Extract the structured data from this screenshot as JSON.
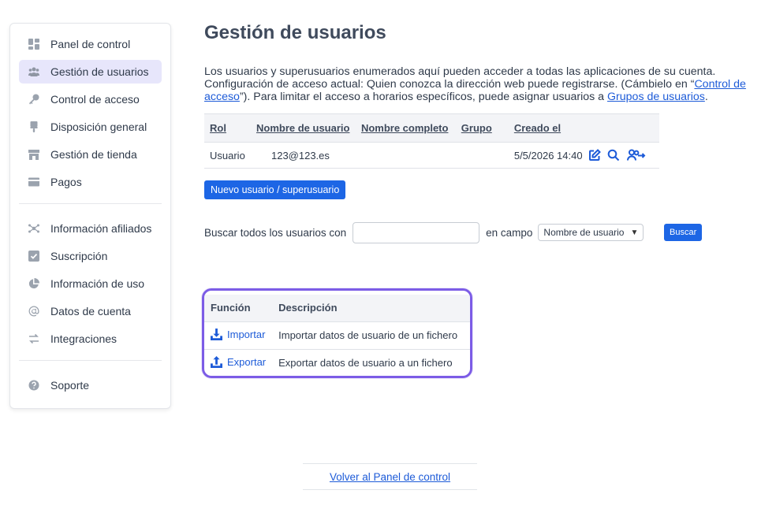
{
  "sidebar": {
    "items": [
      {
        "label": "Panel de control",
        "icon": "dashboard-icon"
      },
      {
        "label": "Gestión de usuarios",
        "icon": "users-icon",
        "active": true
      },
      {
        "label": "Control de acceso",
        "icon": "key-icon"
      },
      {
        "label": "Disposición general",
        "icon": "brush-icon"
      },
      {
        "label": "Gestión de tienda",
        "icon": "store-icon"
      },
      {
        "label": "Pagos",
        "icon": "credit-card-icon"
      }
    ],
    "items2": [
      {
        "label": "Información afiliados",
        "icon": "affiliate-icon"
      },
      {
        "label": "Suscripción",
        "icon": "check-square-icon"
      },
      {
        "label": "Información de uso",
        "icon": "pie-chart-icon"
      },
      {
        "label": "Datos de cuenta",
        "icon": "at-icon"
      },
      {
        "label": "Integraciones",
        "icon": "arrows-icon"
      }
    ],
    "items3": [
      {
        "label": "Soporte",
        "icon": "help-icon"
      }
    ]
  },
  "page": {
    "title": "Gestión de usuarios",
    "intro_line1": "Los usuarios y superusuarios enumerados aquí pueden acceder a todas las aplicaciones de su cuenta.",
    "intro_line2_pre": "Configuración de acceso actual: Quien conozca la dirección web puede registrarse. (Cámbielo en “",
    "intro_link1": "Control de acceso",
    "intro_line2_mid": "”). Para limitar el acceso a horarios específicos, puede asignar usuarios a ",
    "intro_link2": "Grupos de usuarios",
    "intro_end": "."
  },
  "users_table": {
    "headers": {
      "rol": "Rol",
      "usuario": "Nombre de usuario",
      "completo": "Nombre completo",
      "grupo": "Grupo",
      "creado": "Creado el"
    },
    "rows": [
      {
        "rol": "Usuario",
        "usuario": "123@123.es",
        "completo": "",
        "grupo": "",
        "creado": "5/5/2026 14:40"
      }
    ]
  },
  "new_user_button": "Nuevo usuario / superusuario",
  "search": {
    "label": "Buscar todos los usuarios con",
    "value": "",
    "field_label": "en campo",
    "field_value": "Nombre de usuario",
    "button": "Buscar"
  },
  "functions": {
    "headers": {
      "funcion": "Función",
      "descripcion": "Descripción"
    },
    "rows": [
      {
        "label": "Importar",
        "description": "Importar datos de usuario de un fichero",
        "icon": "download-icon"
      },
      {
        "label": "Exportar",
        "description": "Exportar datos de usuario a un fichero",
        "icon": "upload-icon"
      }
    ],
    "highlight_color": "#7c5ce6"
  },
  "back_link": "Volver al Panel de control",
  "colors": {
    "accent": "#1d66e5",
    "active_bg": "#e7e6fb",
    "link": "#1d5bd8"
  }
}
